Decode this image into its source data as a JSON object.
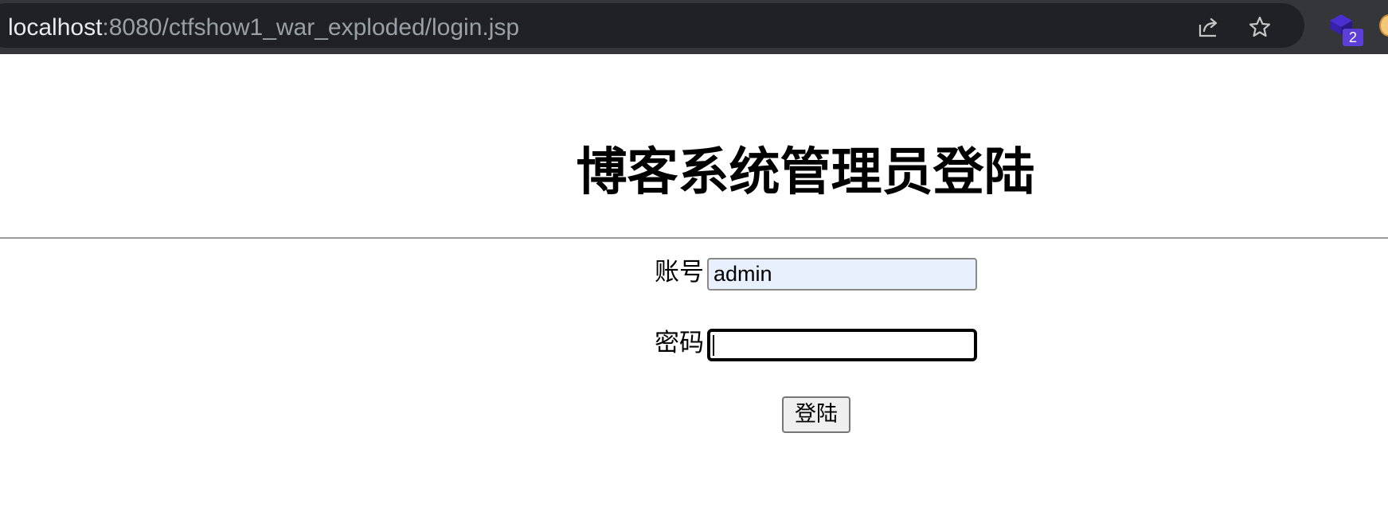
{
  "browser": {
    "url_host": "localhost",
    "url_rest": ":8080/ctfshow1_war_exploded/login.jsp",
    "icons": [
      "site-info-icon",
      "share-icon",
      "star-icon",
      "extension-icon",
      "profile-icon"
    ],
    "extension_badge": "2",
    "accent_color": "#5b3fd6"
  },
  "page": {
    "title": "博客系统管理员登陆"
  },
  "form": {
    "account_label": "账号",
    "account_value": "admin",
    "password_label": "密码",
    "password_value": "",
    "submit_label": "登陆"
  }
}
